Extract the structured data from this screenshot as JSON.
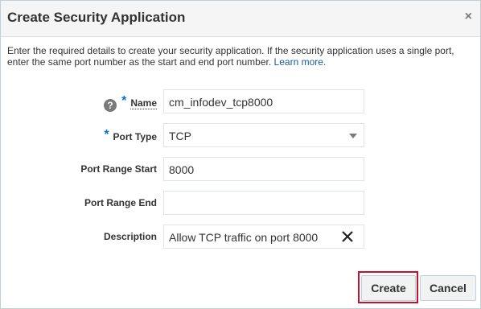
{
  "dialog": {
    "title": "Create Security Application",
    "close_glyph": "×",
    "intro_text": "Enter the required details to create your security application. If the security application uses a single port, enter the same port number as the start and end port number.",
    "learn_more": "Learn more."
  },
  "form": {
    "name": {
      "label": "Name",
      "required_mark": "*",
      "help_glyph": "?",
      "value": "cm_infodev_tcp8000"
    },
    "port_type": {
      "label": "Port Type",
      "required_mark": "*",
      "value": "TCP"
    },
    "port_range_start": {
      "label": "Port Range Start",
      "value": "8000"
    },
    "port_range_end": {
      "label": "Port Range End",
      "value": ""
    },
    "description": {
      "label": "Description",
      "value": "Allow TCP traffic on port 8000"
    }
  },
  "buttons": {
    "create": "Create",
    "cancel": "Cancel"
  },
  "colors": {
    "required_asterisk": "#0572ce",
    "link": "#145c9e",
    "highlight_border": "#c8102e"
  },
  "icons": {
    "close": "close-icon",
    "help": "help-icon",
    "dropdown": "chevron-down-icon",
    "clear": "clear-icon"
  }
}
